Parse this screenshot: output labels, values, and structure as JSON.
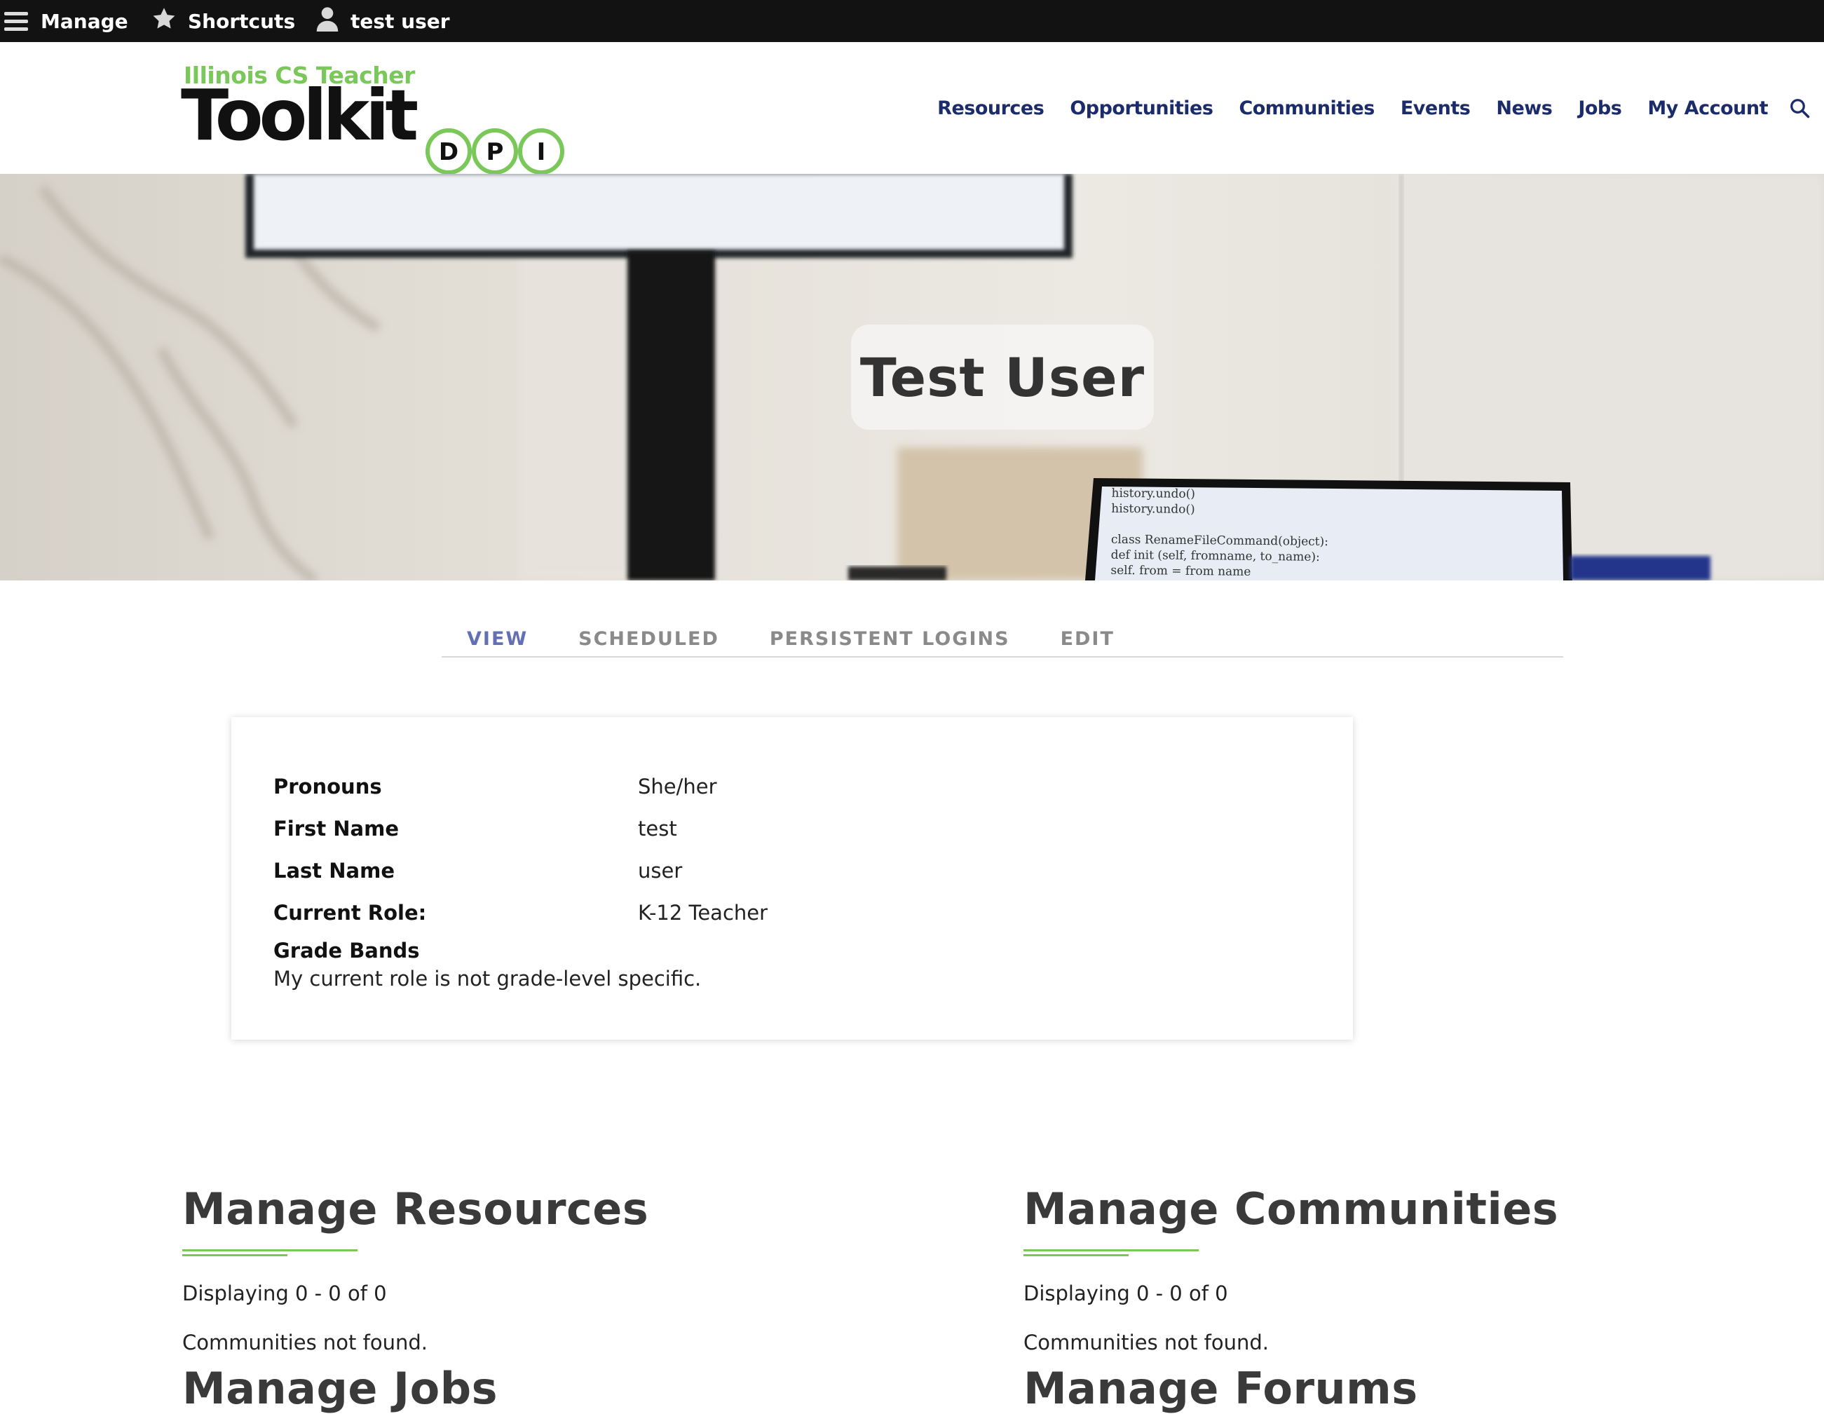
{
  "toolbar": {
    "manage_label": "Manage",
    "shortcuts_label": "Shortcuts",
    "user_label": "test user"
  },
  "logo": {
    "subtitle": "Illinois CS Teacher",
    "title": "Toolkit",
    "badge_letters": [
      "D",
      "P",
      "I"
    ]
  },
  "nav": {
    "items": [
      "Resources",
      "Opportunities",
      "Communities",
      "Events",
      "News",
      "Jobs",
      "My Account"
    ],
    "search_icon": "search-icon"
  },
  "hero": {
    "title": "Test User",
    "code_lines": [
      "history.undo()",
      "history.undo()",
      "",
      "class RenameFileCommand(object):",
      "def  init  (self, fromname, to_name):",
      "self.  from  = from  name"
    ]
  },
  "tabs": [
    {
      "label": "VIEW",
      "active": true
    },
    {
      "label": "SCHEDULED",
      "active": false
    },
    {
      "label": "PERSISTENT LOGINS",
      "active": false
    },
    {
      "label": "EDIT",
      "active": false
    }
  ],
  "profile": {
    "fields": [
      {
        "label": "Pronouns",
        "value": "She/her"
      },
      {
        "label": "First Name",
        "value": "test"
      },
      {
        "label": "Last Name",
        "value": "user"
      },
      {
        "label": "Current Role:",
        "value": "K-12 Teacher"
      }
    ],
    "grade_bands_label": "Grade Bands",
    "grade_bands_value": "My current role is not grade-level specific."
  },
  "sections": {
    "resources": {
      "title": "Manage Resources",
      "display": "Displaying 0 - 0 of 0",
      "not_found": "Communities not found.",
      "next_title": "Manage Jobs"
    },
    "communities": {
      "title": "Manage Communities",
      "display": "Displaying 0 - 0 of 0",
      "not_found": "Communities not found.",
      "next_title": "Manage Forums"
    }
  },
  "colors": {
    "toolbar_bg": "#121212",
    "brand_green": "#7ac75a",
    "nav_blue": "#1c2c6b",
    "tab_active": "#6470b5",
    "tab_inactive": "#8a8a8a"
  }
}
